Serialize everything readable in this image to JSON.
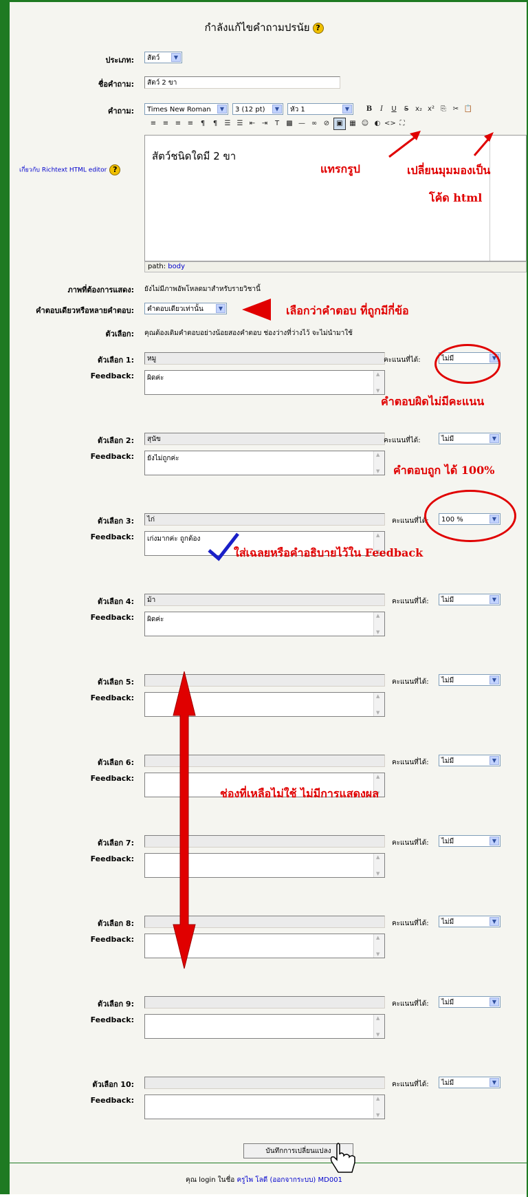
{
  "page_title": "กำลังแก้ไขคำถามปรนัย",
  "fields": {
    "category_label": "ประเภท:",
    "category_value": "สัตว์",
    "name_label": "ชื่อคำถาม:",
    "name_value": "สัตว์ 2 ขา",
    "question_label": "คำถาม:",
    "help_link": "เกี่ยวกับ Richtext HTML editor",
    "image_label": "ภาพที่ต้องการแสดง:",
    "image_value": "ยังไม่มีภาพอัพโหลดมาสำหรับรายวิชานี้",
    "answers_mode_label": "คำตอบเดียวหรือหลายคำตอบ:",
    "answers_mode_value": "คำตอบเดียวเท่านั้น",
    "choices_label": "ตัวเลือก:",
    "choices_hint": "คุณต้องเติมคำตอบอย่างน้อยสองคำตอบ ช่องว่างที่ว่างไว้ จะไม่นำมาใช้"
  },
  "editor": {
    "font": "Times New Roman",
    "size": "3 (12 pt)",
    "heading": "หัว 1",
    "content": "สัตว์ชนิดใดมี 2 ขา",
    "path_label": "path:",
    "path_value": "body"
  },
  "choices": [
    {
      "label": "ตัวเลือก 1:",
      "answer": "หมู",
      "grade_label": "คะแนนที่ได้:",
      "grade": "ไม่มี",
      "fb_label": "Feedback:",
      "feedback": "ผิดค่ะ"
    },
    {
      "label": "ตัวเลือก 2:",
      "answer": "สุนัข",
      "grade_label": "คะแนนที่ได้:",
      "grade": "ไม่มี",
      "fb_label": "Feedback:",
      "feedback": "ยังไม่ถูกค่ะ"
    },
    {
      "label": "ตัวเลือก 3:",
      "answer": "ไก่",
      "grade_label": "คะแนนที่ได้:",
      "grade": "100 %",
      "fb_label": "Feedback:",
      "feedback": "เก่งมากค่ะ ถูกต้อง"
    },
    {
      "label": "ตัวเลือก 4:",
      "answer": "ม้า",
      "grade_label": "คะแนนที่ได้:",
      "grade": "ไม่มี",
      "fb_label": "Feedback:",
      "feedback": "ผิดค่ะ"
    },
    {
      "label": "ตัวเลือก 5:",
      "answer": "",
      "grade_label": "คะแนนที่ได้:",
      "grade": "ไม่มี",
      "fb_label": "Feedback:",
      "feedback": ""
    },
    {
      "label": "ตัวเลือก 6:",
      "answer": "",
      "grade_label": "คะแนนที่ได้:",
      "grade": "ไม่มี",
      "fb_label": "Feedback:",
      "feedback": ""
    },
    {
      "label": "ตัวเลือก 7:",
      "answer": "",
      "grade_label": "คะแนนที่ได้:",
      "grade": "ไม่มี",
      "fb_label": "Feedback:",
      "feedback": ""
    },
    {
      "label": "ตัวเลือก 8:",
      "answer": "",
      "grade_label": "คะแนนที่ได้:",
      "grade": "ไม่มี",
      "fb_label": "Feedback:",
      "feedback": ""
    },
    {
      "label": "ตัวเลือก 9:",
      "answer": "",
      "grade_label": "คะแนนที่ได้:",
      "grade": "ไม่มี",
      "fb_label": "Feedback:",
      "feedback": ""
    },
    {
      "label": "ตัวเลือก 10:",
      "answer": "",
      "grade_label": "คะแนนที่ได้:",
      "grade": "ไม่มี",
      "fb_label": "Feedback:",
      "feedback": ""
    }
  ],
  "annotations": {
    "insert_image": "แทรกรูป",
    "html_view_1": "เปลี่ยนมุมมองเป็น",
    "html_view_2": "โค้ด html",
    "answer_count": "เลือกว่าคำตอบ ที่ถูกมีกี่ข้อ",
    "wrong_no_score": "คำตอบผิดไม่มีคะแนน",
    "correct_100": "คำตอบถูก ได้ 100%",
    "feedback_note": "ใส่เฉลยหรือคำอธิบายไว้ใน Feedback",
    "unused_slots": "ช่องที่เหลือไม่ใช้ ไม่มีการแสดงผล"
  },
  "save_button": "บันทึกการเปลี่ยนแปลง",
  "footer": {
    "prefix": "คุณ login ในชื่อ",
    "user": "ครูไพ โลดี",
    "logout": "(ออกจากระบบ)",
    "course": "MD001"
  },
  "colors": {
    "border": "#1e7a22",
    "annotation": "#e00000",
    "link": "#0000cc"
  }
}
